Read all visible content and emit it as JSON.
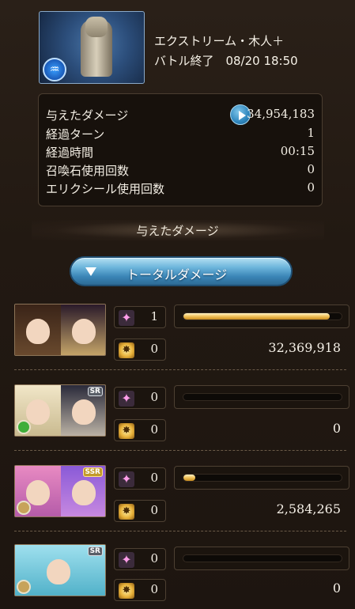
{
  "header": {
    "title": "エクストリーム・木人＋",
    "subtitle": "バトル終了　08/20 18:50",
    "thumbnail_icon": "training-dummy-icon"
  },
  "summary": {
    "rows": [
      {
        "label": "与えたダメージ",
        "value": "34,954,183"
      },
      {
        "label": "経過ターン",
        "value": "1"
      },
      {
        "label": "経過時間",
        "value": "00:15"
      },
      {
        "label": "召喚石使用回数",
        "value": "0"
      },
      {
        "label": "エリクシール使用回数",
        "value": "0"
      }
    ]
  },
  "section_title": "与えたダメージ",
  "total_button_label": "トータルダメージ",
  "members": [
    {
      "skill_count": "1",
      "ougi_count": "0",
      "damage": "32,369,918",
      "ratio": 0.926,
      "rarity": "",
      "element_color": "#c09a5a"
    },
    {
      "skill_count": "0",
      "ougi_count": "0",
      "damage": "0",
      "ratio": 0,
      "rarity": "SR",
      "element_color": "#3fae3a"
    },
    {
      "skill_count": "0",
      "ougi_count": "0",
      "damage": "2,584,265",
      "ratio": 0.074,
      "rarity": "SSR",
      "element_color": "#c7a35a"
    },
    {
      "skill_count": "0",
      "ougi_count": "0",
      "damage": "0",
      "ratio": 0,
      "rarity": "SR",
      "element_color": "#c7a35a"
    }
  ],
  "colors": {
    "bar_fill": "#f0c25a",
    "button_blue": "#3a85b6",
    "panel_bg": "#17110c"
  }
}
